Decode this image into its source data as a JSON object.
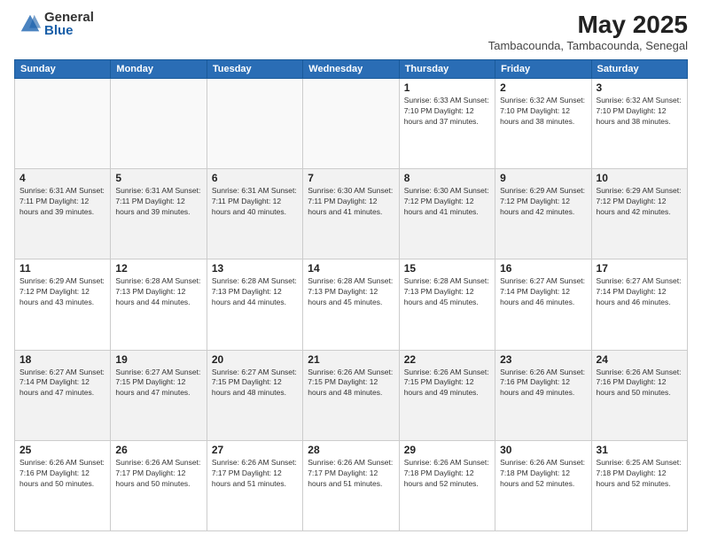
{
  "logo": {
    "general": "General",
    "blue": "Blue"
  },
  "title": {
    "month_year": "May 2025",
    "location": "Tambacounda, Tambacounda, Senegal"
  },
  "days_of_week": [
    "Sunday",
    "Monday",
    "Tuesday",
    "Wednesday",
    "Thursday",
    "Friday",
    "Saturday"
  ],
  "weeks": [
    [
      {
        "day": "",
        "info": ""
      },
      {
        "day": "",
        "info": ""
      },
      {
        "day": "",
        "info": ""
      },
      {
        "day": "",
        "info": ""
      },
      {
        "day": "1",
        "info": "Sunrise: 6:33 AM\nSunset: 7:10 PM\nDaylight: 12 hours\nand 37 minutes."
      },
      {
        "day": "2",
        "info": "Sunrise: 6:32 AM\nSunset: 7:10 PM\nDaylight: 12 hours\nand 38 minutes."
      },
      {
        "day": "3",
        "info": "Sunrise: 6:32 AM\nSunset: 7:10 PM\nDaylight: 12 hours\nand 38 minutes."
      }
    ],
    [
      {
        "day": "4",
        "info": "Sunrise: 6:31 AM\nSunset: 7:11 PM\nDaylight: 12 hours\nand 39 minutes."
      },
      {
        "day": "5",
        "info": "Sunrise: 6:31 AM\nSunset: 7:11 PM\nDaylight: 12 hours\nand 39 minutes."
      },
      {
        "day": "6",
        "info": "Sunrise: 6:31 AM\nSunset: 7:11 PM\nDaylight: 12 hours\nand 40 minutes."
      },
      {
        "day": "7",
        "info": "Sunrise: 6:30 AM\nSunset: 7:11 PM\nDaylight: 12 hours\nand 41 minutes."
      },
      {
        "day": "8",
        "info": "Sunrise: 6:30 AM\nSunset: 7:12 PM\nDaylight: 12 hours\nand 41 minutes."
      },
      {
        "day": "9",
        "info": "Sunrise: 6:29 AM\nSunset: 7:12 PM\nDaylight: 12 hours\nand 42 minutes."
      },
      {
        "day": "10",
        "info": "Sunrise: 6:29 AM\nSunset: 7:12 PM\nDaylight: 12 hours\nand 42 minutes."
      }
    ],
    [
      {
        "day": "11",
        "info": "Sunrise: 6:29 AM\nSunset: 7:12 PM\nDaylight: 12 hours\nand 43 minutes."
      },
      {
        "day": "12",
        "info": "Sunrise: 6:28 AM\nSunset: 7:13 PM\nDaylight: 12 hours\nand 44 minutes."
      },
      {
        "day": "13",
        "info": "Sunrise: 6:28 AM\nSunset: 7:13 PM\nDaylight: 12 hours\nand 44 minutes."
      },
      {
        "day": "14",
        "info": "Sunrise: 6:28 AM\nSunset: 7:13 PM\nDaylight: 12 hours\nand 45 minutes."
      },
      {
        "day": "15",
        "info": "Sunrise: 6:28 AM\nSunset: 7:13 PM\nDaylight: 12 hours\nand 45 minutes."
      },
      {
        "day": "16",
        "info": "Sunrise: 6:27 AM\nSunset: 7:14 PM\nDaylight: 12 hours\nand 46 minutes."
      },
      {
        "day": "17",
        "info": "Sunrise: 6:27 AM\nSunset: 7:14 PM\nDaylight: 12 hours\nand 46 minutes."
      }
    ],
    [
      {
        "day": "18",
        "info": "Sunrise: 6:27 AM\nSunset: 7:14 PM\nDaylight: 12 hours\nand 47 minutes."
      },
      {
        "day": "19",
        "info": "Sunrise: 6:27 AM\nSunset: 7:15 PM\nDaylight: 12 hours\nand 47 minutes."
      },
      {
        "day": "20",
        "info": "Sunrise: 6:27 AM\nSunset: 7:15 PM\nDaylight: 12 hours\nand 48 minutes."
      },
      {
        "day": "21",
        "info": "Sunrise: 6:26 AM\nSunset: 7:15 PM\nDaylight: 12 hours\nand 48 minutes."
      },
      {
        "day": "22",
        "info": "Sunrise: 6:26 AM\nSunset: 7:15 PM\nDaylight: 12 hours\nand 49 minutes."
      },
      {
        "day": "23",
        "info": "Sunrise: 6:26 AM\nSunset: 7:16 PM\nDaylight: 12 hours\nand 49 minutes."
      },
      {
        "day": "24",
        "info": "Sunrise: 6:26 AM\nSunset: 7:16 PM\nDaylight: 12 hours\nand 50 minutes."
      }
    ],
    [
      {
        "day": "25",
        "info": "Sunrise: 6:26 AM\nSunset: 7:16 PM\nDaylight: 12 hours\nand 50 minutes."
      },
      {
        "day": "26",
        "info": "Sunrise: 6:26 AM\nSunset: 7:17 PM\nDaylight: 12 hours\nand 50 minutes."
      },
      {
        "day": "27",
        "info": "Sunrise: 6:26 AM\nSunset: 7:17 PM\nDaylight: 12 hours\nand 51 minutes."
      },
      {
        "day": "28",
        "info": "Sunrise: 6:26 AM\nSunset: 7:17 PM\nDaylight: 12 hours\nand 51 minutes."
      },
      {
        "day": "29",
        "info": "Sunrise: 6:26 AM\nSunset: 7:18 PM\nDaylight: 12 hours\nand 52 minutes."
      },
      {
        "day": "30",
        "info": "Sunrise: 6:26 AM\nSunset: 7:18 PM\nDaylight: 12 hours\nand 52 minutes."
      },
      {
        "day": "31",
        "info": "Sunrise: 6:25 AM\nSunset: 7:18 PM\nDaylight: 12 hours\nand 52 minutes."
      }
    ]
  ]
}
